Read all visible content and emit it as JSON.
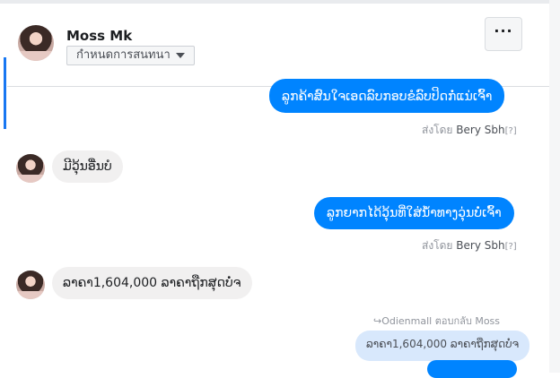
{
  "header": {
    "contact_name": "Moss Mk",
    "assign_label": "กำหนดการสนทนา",
    "more_label": "···"
  },
  "messages": [
    {
      "direction": "out",
      "text": "ລູກຄ້າສົນໃຈເອດລົບກອບຂໍລົບປິດກໍ່ແນ່ເຈົ້າ",
      "sent_by_prefix": "ส่งโดย",
      "sent_by_name": "Bery Sbh",
      "sent_by_help": "[?]"
    },
    {
      "direction": "in",
      "text": "ມີວຸ້ນອື່ນບໍ"
    },
    {
      "direction": "out",
      "text": "ລູກຍາກໄດ້ວຸ້ນທີ່ໃສ່ນ້ຳທາງວຸ່ນບໍ່ເຈົ້າ",
      "sent_by_prefix": "ส่งโดย",
      "sent_by_name": "Bery Sbh",
      "sent_by_help": "[?]"
    },
    {
      "direction": "in",
      "text": "ລາຄາ1,604,000 ລາຄາຖືກສຸດບໍ່ຈ"
    }
  ],
  "reply": {
    "meta": "↪Odienmall ตอบกลับ Moss",
    "quoted_text": "ລາຄາ1,604,000 ລາຄາຖືກສຸດບໍ່ຈ"
  }
}
